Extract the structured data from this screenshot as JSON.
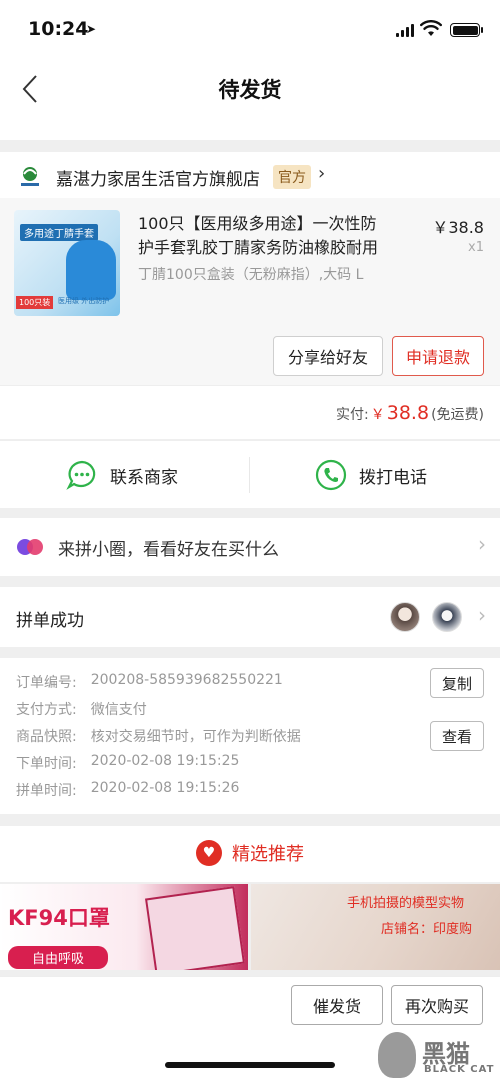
{
  "status_bar": {
    "time": "10:24"
  },
  "nav": {
    "title": "待发货"
  },
  "store": {
    "name": "嘉湛力家居生活官方旗舰店",
    "badge": "官方"
  },
  "product": {
    "image_title": "多用途丁腈手套",
    "image_tag": "100只装",
    "image_tag2": "医用级 外出防护",
    "title": "100只【医用级多用途】一次性防护手套乳胶丁腈家务防油橡胶耐用",
    "spec": "丁腈100只盒装（无粉麻指）,大码 L",
    "price": "￥38.8",
    "qty": "x1"
  },
  "actions": {
    "share": "分享给好友",
    "refund": "申请退款"
  },
  "payment": {
    "label": "实付:",
    "currency": "￥",
    "amount": "38.8",
    "note": "(免运费)"
  },
  "contact": {
    "merchant": "联系商家",
    "call": "拨打电话"
  },
  "circle": {
    "text": "来拼小圈，看看好友在买什么"
  },
  "group": {
    "title": "拼单成功"
  },
  "order": {
    "rows": [
      {
        "label": "订单编号:",
        "value": "200208-585939682550221"
      },
      {
        "label": "支付方式:",
        "value": "微信支付"
      },
      {
        "label": "商品快照:",
        "value": "核对交易细节时，可作为判断依据"
      },
      {
        "label": "下单时间:",
        "value": "2020-02-08 19:15:25"
      },
      {
        "label": "拼单时间:",
        "value": "2020-02-08 19:15:26"
      }
    ],
    "copy_label": "复制",
    "view_label": "查看"
  },
  "recommend": {
    "title": "精选推荐",
    "banner1_title": "KF94口罩",
    "banner1_sub": "自由呼吸",
    "banner2_line1": "手机拍摄的模型实物",
    "banner2_line2": "店铺名：印度购"
  },
  "bottom": {
    "urge": "催发货",
    "rebuy": "再次购买"
  },
  "watermark": {
    "top": "黑猫",
    "bottom": "BLACK CAT"
  },
  "colors": {
    "accent": "#e02e24",
    "wechat_green": "#2fb34a"
  }
}
